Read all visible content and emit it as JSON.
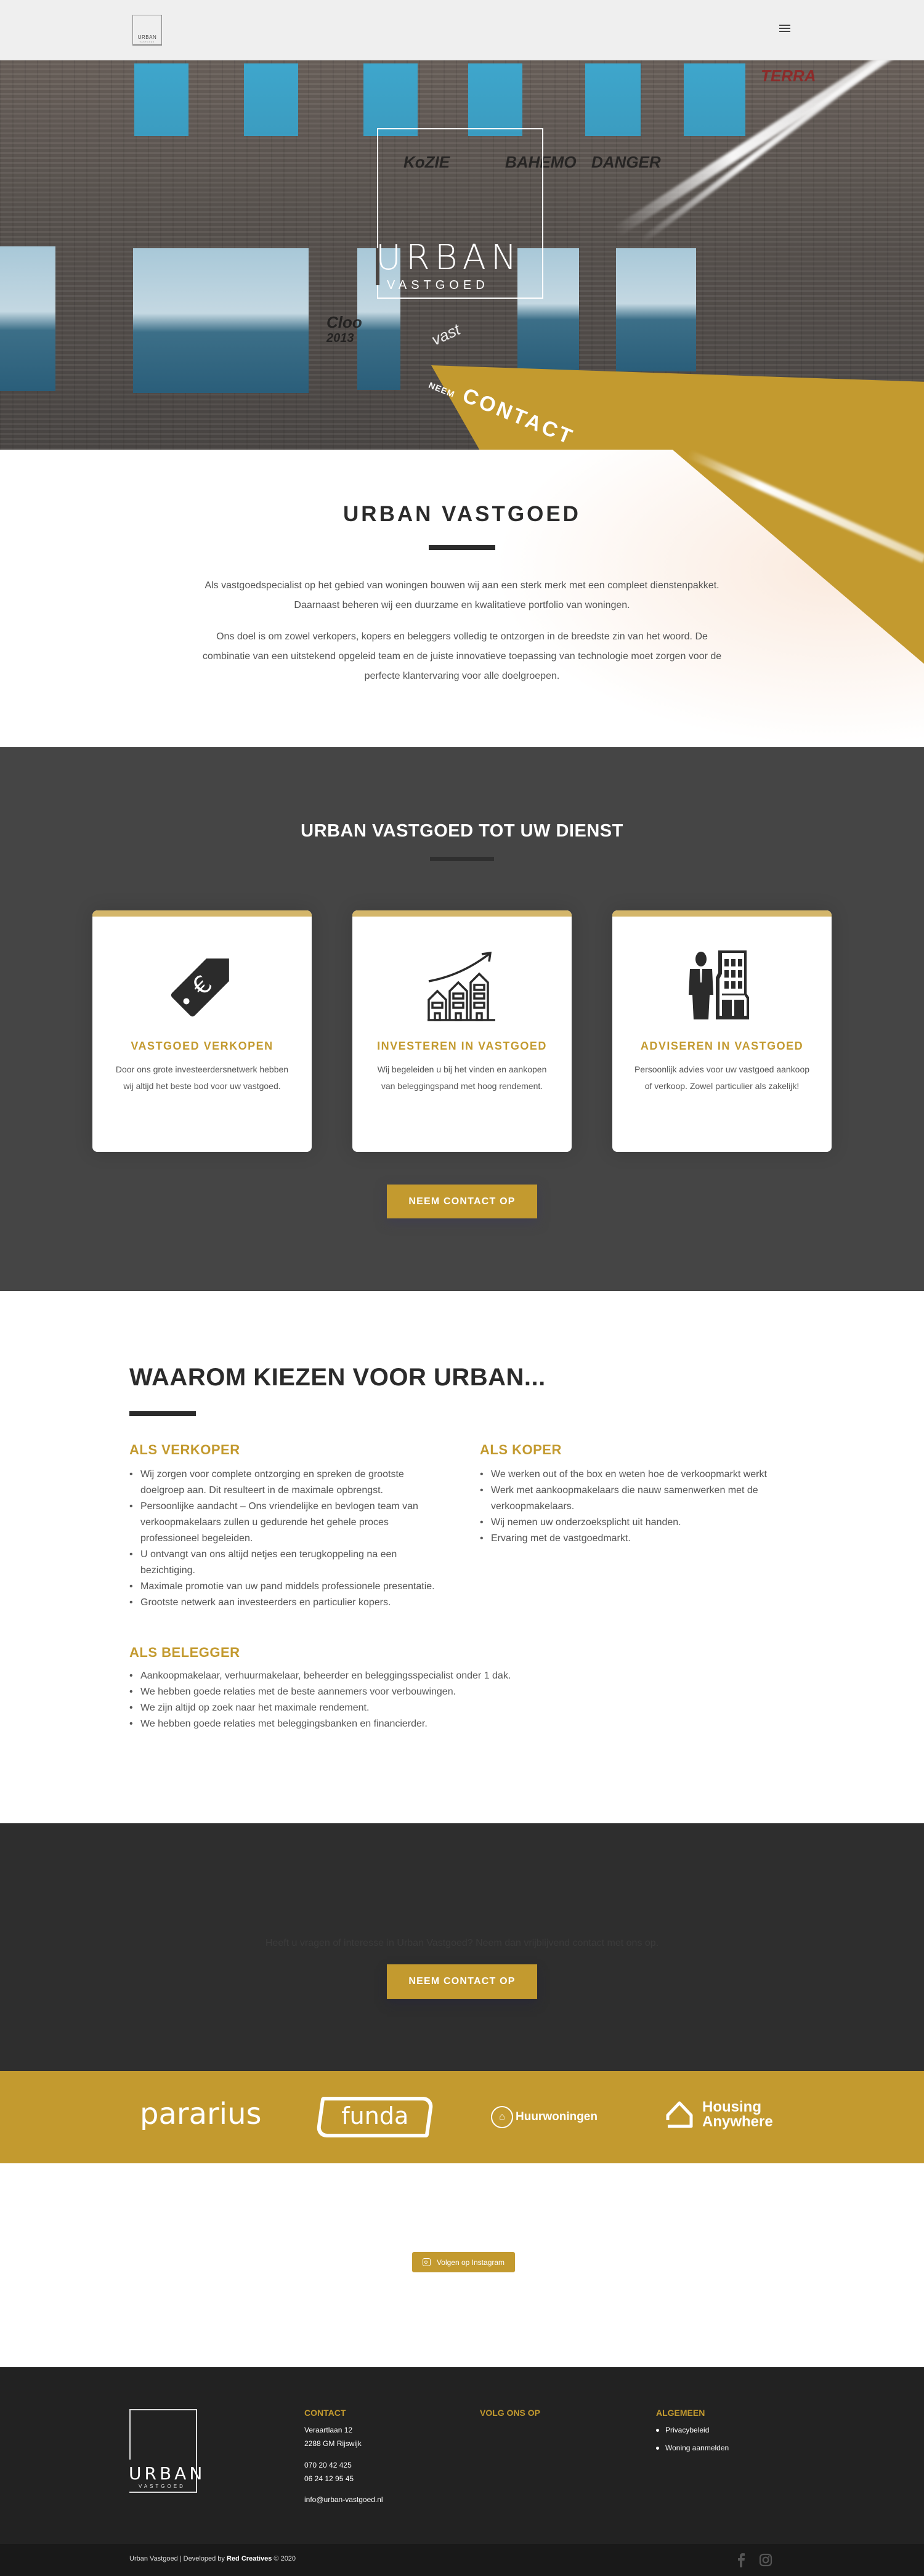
{
  "header": {
    "logo_text": "URBAN",
    "logo_sub": "VASTGOED",
    "menu_icon": "hamburger-menu-icon"
  },
  "hero": {
    "logo_text": "URBAN",
    "logo_sub": "VASTGOED",
    "tagline_fragment": "vast",
    "cta_small": "NEEM",
    "cta_text": "CONTACT"
  },
  "intro": {
    "title": "URBAN VASTGOED",
    "paragraphs": [
      "Als vastgoedspecialist op het gebied van woningen bouwen wij aan een sterk merk met een compleet dienstenpakket. Daarnaast beheren wij een duurzame en kwalitatieve portfolio van woningen.",
      "Ons doel is om zowel verkopers, kopers en beleggers volledig te ontzorgen in de breedste zin van het woord. De combinatie van een uitstekend opgeleid team en de juiste innovatieve toepassing van technologie moet zorgen voor de perfecte klantervaring voor alle doelgroepen."
    ]
  },
  "services": {
    "title": "URBAN VASTGOED TOT UW DIENST",
    "cards": [
      {
        "icon": "euro-price-tag-icon",
        "title": "VASTGOED VERKOPEN",
        "text": "Door ons grote investeerdersnetwerk hebben wij altijd het beste bod voor uw vastgoed."
      },
      {
        "icon": "rising-houses-chart-icon",
        "title": "INVESTEREN IN VASTGOED",
        "text": "Wij begeleiden u bij het vinden en aankopen van beleggingspand met hoog rendement."
      },
      {
        "icon": "businessman-building-icon",
        "title": "ADVISEREN IN VASTGOED",
        "text": "Persoonlijk advies voor uw vastgoed aankoop of verkoop. Zowel particulier als zakelijk!"
      }
    ],
    "button_label": "NEEM CONTACT OP"
  },
  "why": {
    "title": "WAAROM KIEZEN VOOR URBAN...",
    "groups": [
      {
        "title": "ALS VERKOPER",
        "items": [
          "Wij zorgen voor complete ontzorging en spreken de grootste doelgroep aan. Dit resulteert in de maximale opbrengst.",
          "Persoonlijke aandacht – Ons vriendelijke en bevlogen team van verkoopmakelaars zullen u gedurende het gehele proces professioneel begeleiden.",
          "U ontvangt van ons altijd netjes een terugkoppeling na een bezichtiging.",
          "Maximale promotie van uw pand middels professionele presentatie.",
          "Grootste netwerk aan investeerders en particulier kopers."
        ]
      },
      {
        "title": "ALS KOPER",
        "items": [
          "We werken out of the box en weten hoe de verkoopmarkt werkt",
          "Werk met aankoopmakelaars die nauw samenwerken met de verkoopmakelaars.",
          "Wij nemen uw onderzoeksplicht uit handen.",
          "Ervaring met de vastgoedmarkt."
        ]
      },
      {
        "title": "ALS BELEGGER",
        "items": [
          "Aankoopmakelaar, verhuurmakelaar, beheerder en beleggingsspecialist onder 1 dak.",
          "We hebben goede relaties met de beste aannemers voor verbouwingen.",
          "We zijn altijd op zoek naar het maximale rendement.",
          "We hebben goede relaties met beleggingsbanken en financierder."
        ]
      }
    ]
  },
  "cta": {
    "text": "Heeft u vragen of interesse in Urban Vastgoed? Neem dan vrijblijvend contact met ons op.",
    "button_label": "NEEM CONTACT OP"
  },
  "partners": {
    "pararius": "pararius",
    "funda": "funda",
    "huurwoningen": "Huurwoningen",
    "housing_line1": "Housing",
    "housing_line2": "Anywhere"
  },
  "instagram": {
    "button_label": "Volgen op Instagram"
  },
  "footer": {
    "logo_text": "URBAN",
    "logo_sub": "VASTGOED",
    "contact_title": "CONTACT",
    "address_line1": "Veraartlaan 12",
    "address_line2": "2288 GM Rijswijk",
    "phone1": "070 20 42 425",
    "phone2": "06 24 12 95 45",
    "email": "info@urban-vastgoed.nl",
    "follow_title": "VOLG ONS OP",
    "general_title": "ALGEMEEN",
    "general_links": [
      "Privacybeleid",
      "Woning aanmelden"
    ],
    "copyright_prefix": "Urban Vastgoed | Developed by ",
    "developer": "Red Creatives",
    "copyright_suffix": " © 2020"
  },
  "colors": {
    "accent_gold": "#c39a2f",
    "card_bar": "#d4b66a",
    "dark_section": "#454545",
    "cta_section": "#2e2e2e",
    "footer": "#222222",
    "footer_bottom": "#191919"
  }
}
